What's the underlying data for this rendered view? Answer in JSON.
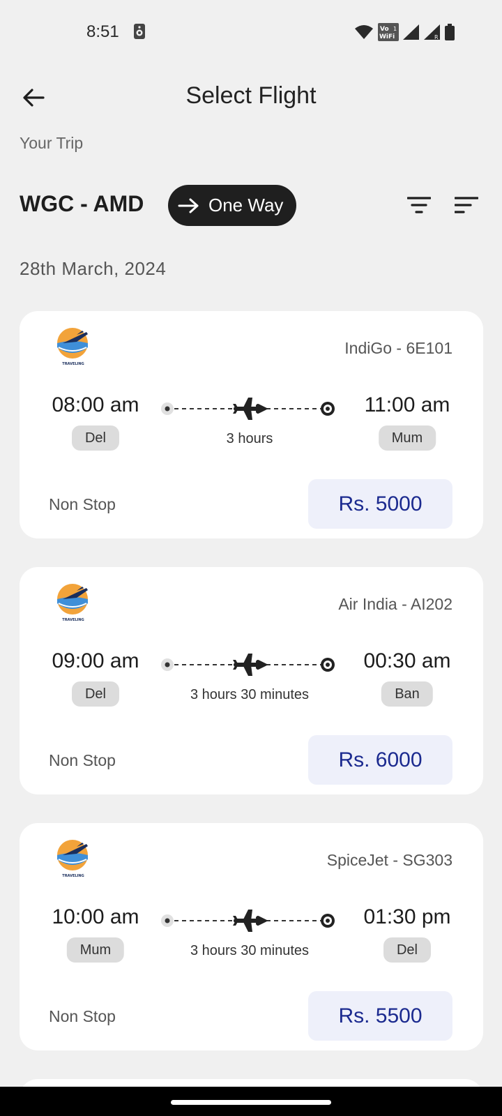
{
  "status_bar": {
    "time": "8:51",
    "icons": [
      "cast-icon",
      "wifi-icon",
      "vowifi-icon",
      "signal-icon",
      "signal-roaming-icon",
      "battery-icon"
    ],
    "vowifi_text_top": "Vo",
    "vowifi_text_sub": "1",
    "vowifi_text_bottom": "WiFi",
    "roaming_badge": "R"
  },
  "header": {
    "title": "Select Flight",
    "back_icon": "arrow-left-icon"
  },
  "trip": {
    "label": "Your Trip",
    "route": "WGC - AMD",
    "trip_type": "One Way",
    "filter_icon": "filter-icon",
    "sort_icon": "sort-icon"
  },
  "date": "28th March, 2024",
  "logo_caption": "TRAVELING",
  "flights": [
    {
      "airline": "IndiGo - 6E101",
      "departure_time": "08:00 am",
      "departure_code": "Del",
      "arrival_time": "11:00 am",
      "arrival_code": "Mum",
      "duration": "3 hours",
      "stops": "Non Stop",
      "price": "Rs. 5000"
    },
    {
      "airline": "Air India - AI202",
      "departure_time": "09:00 am",
      "departure_code": "Del",
      "arrival_time": "00:30 am",
      "arrival_code": "Ban",
      "duration": "3 hours 30 minutes",
      "stops": "Non Stop",
      "price": "Rs. 6000"
    },
    {
      "airline": "SpiceJet - SG303",
      "departure_time": "10:00 am",
      "departure_code": "Mum",
      "arrival_time": "01:30 pm",
      "arrival_code": "Del",
      "duration": "3 hours 30 minutes",
      "stops": "Non Stop",
      "price": "Rs. 5500"
    }
  ],
  "colors": {
    "background": "#f0f0f0",
    "card": "#ffffff",
    "pill": "#1f1f1f",
    "price_bg": "#eef0fa",
    "price_text": "#1b2a8f",
    "chip": "#dcdcdc"
  }
}
